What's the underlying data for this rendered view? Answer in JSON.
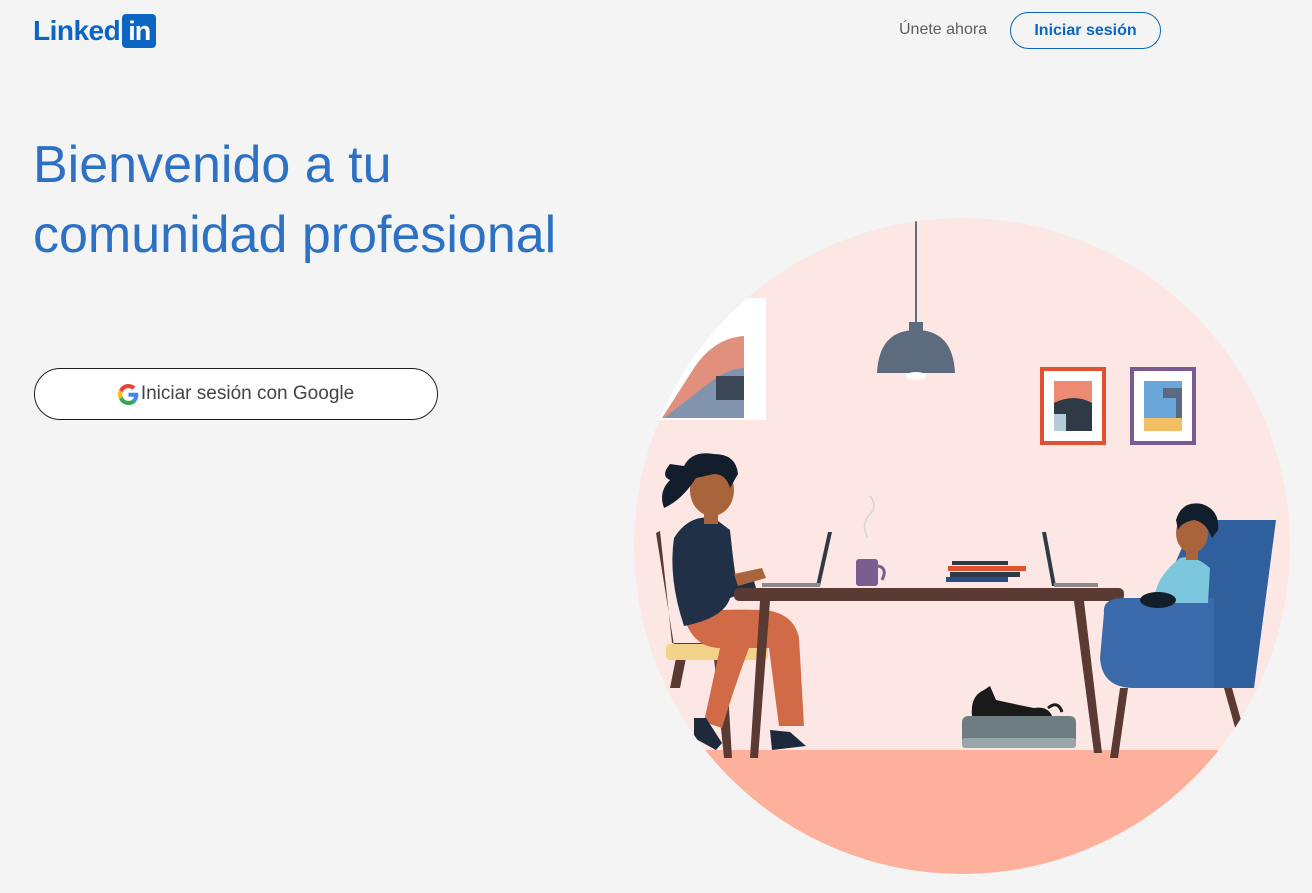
{
  "header": {
    "logo_word": "Linked",
    "logo_box": "in",
    "join_label": "Únete ahora",
    "signin_label": "Iniciar sesión"
  },
  "hero": {
    "title_line1": "Bienvenido a tu",
    "title_line2": "comunidad profesional",
    "google_button_label": "Iniciar sesión con Google",
    "google_icon": "google-g-icon"
  },
  "colors": {
    "brand": "#0a66c2",
    "title": "#2d71c4",
    "background": "#f4f4f4"
  }
}
